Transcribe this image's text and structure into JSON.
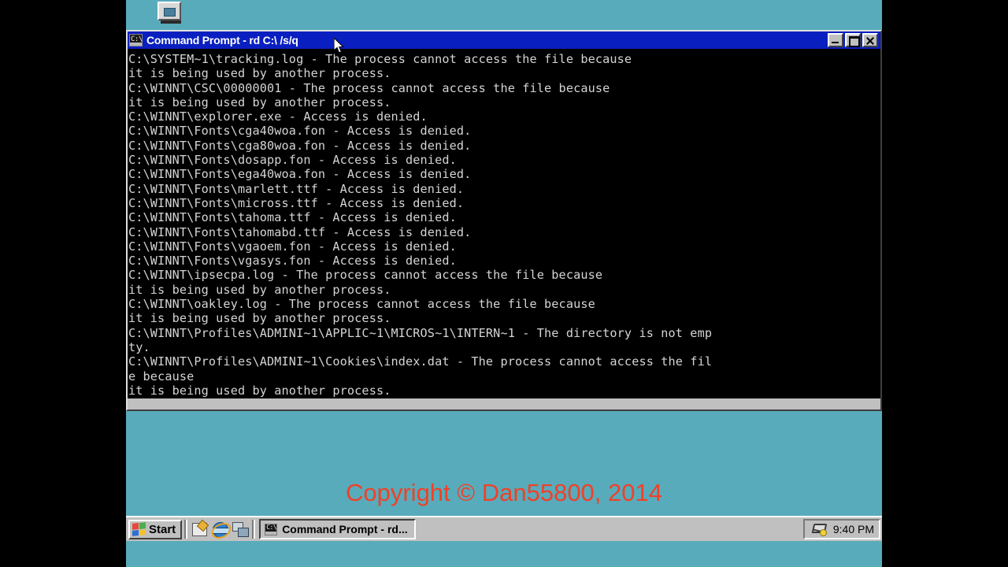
{
  "colors": {
    "desktop": "#58abbb",
    "titlebar": "#0a1fc0",
    "chrome": "#c0c0c0",
    "console_bg": "#000000",
    "console_fg": "#d4d4d4",
    "watermark": "#ef4128"
  },
  "desktop": {
    "icon_name": "my-computer"
  },
  "watermark": {
    "text": "Copyright © Dan55800, 2014"
  },
  "window": {
    "title": "Command Prompt - rd C:\\ /s/q",
    "icon": "ms-dos-console-icon",
    "minimize_label": "",
    "maximize_label": "",
    "close_label": "",
    "console_lines": [
      "C:\\SYSTEM~1\\tracking.log - The process cannot access the file because",
      "it is being used by another process.",
      "C:\\WINNT\\CSC\\00000001 - The process cannot access the file because",
      "it is being used by another process.",
      "C:\\WINNT\\explorer.exe - Access is denied.",
      "C:\\WINNT\\Fonts\\cga40woa.fon - Access is denied.",
      "C:\\WINNT\\Fonts\\cga80woa.fon - Access is denied.",
      "C:\\WINNT\\Fonts\\dosapp.fon - Access is denied.",
      "C:\\WINNT\\Fonts\\ega40woa.fon - Access is denied.",
      "C:\\WINNT\\Fonts\\marlett.ttf - Access is denied.",
      "C:\\WINNT\\Fonts\\micross.ttf - Access is denied.",
      "C:\\WINNT\\Fonts\\tahoma.ttf - Access is denied.",
      "C:\\WINNT\\Fonts\\tahomabd.ttf - Access is denied.",
      "C:\\WINNT\\Fonts\\vgaoem.fon - Access is denied.",
      "C:\\WINNT\\Fonts\\vgasys.fon - Access is denied.",
      "C:\\WINNT\\ipsecpa.log - The process cannot access the file because",
      "it is being used by another process.",
      "C:\\WINNT\\oakley.log - The process cannot access the file because",
      "it is being used by another process.",
      "C:\\WINNT\\Profiles\\ADMINI~1\\APPLIC~1\\MICROS~1\\INTERN~1 - The directory is not emp",
      "ty.",
      "C:\\WINNT\\Profiles\\ADMINI~1\\Cookies\\index.dat - The process cannot access the fil",
      "e because",
      "it is being used by another process."
    ]
  },
  "taskbar": {
    "start_label": "Start",
    "quicklaunch": [
      {
        "name": "show-desktop-icon"
      },
      {
        "name": "internet-explorer-icon"
      },
      {
        "name": "network-connections-icon"
      }
    ],
    "tasks": [
      {
        "name": "command-prompt",
        "label": "Command Prompt - rd..."
      }
    ],
    "tray": {
      "network_icon": "dial-up-connection-icon",
      "clock": "9:40 PM"
    }
  }
}
